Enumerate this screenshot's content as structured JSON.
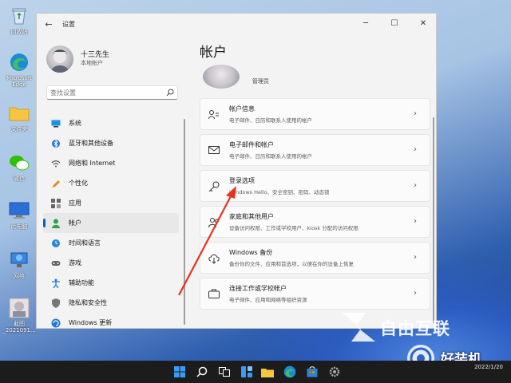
{
  "desktop": {
    "icons": [
      {
        "label": "回收站",
        "icon": "recycle-bin-icon"
      },
      {
        "label": "Microsoft Edge",
        "icon": "edge-icon"
      },
      {
        "label": "文件夹",
        "icon": "folder-icon"
      },
      {
        "label": "微信",
        "icon": "wechat-icon"
      },
      {
        "label": "此电脑",
        "icon": "this-pc-icon"
      },
      {
        "label": "网络",
        "icon": "network-icon"
      },
      {
        "label": "截图_2021091...",
        "icon": "screenshot-file-icon"
      }
    ]
  },
  "window": {
    "title": "设置",
    "back_icon": "back-arrow-icon",
    "controls": {
      "minimize": "─",
      "maximize": "☐",
      "close": "✕"
    }
  },
  "sidebar": {
    "profile": {
      "name": "十三先生",
      "subtitle": "本地帐户"
    },
    "search": {
      "placeholder": "查找设置",
      "value": "查找设置"
    },
    "items": [
      {
        "label": "系统",
        "icon": "system-icon",
        "active": false
      },
      {
        "label": "蓝牙和其他设备",
        "icon": "bluetooth-icon",
        "active": false
      },
      {
        "label": "网络和 Internet",
        "icon": "wifi-icon",
        "active": false
      },
      {
        "label": "个性化",
        "icon": "pen-icon",
        "active": false
      },
      {
        "label": "应用",
        "icon": "apps-icon",
        "active": false
      },
      {
        "label": "帐户",
        "icon": "person-icon",
        "active": true
      },
      {
        "label": "时间和语言",
        "icon": "globe-clock-icon",
        "active": false
      },
      {
        "label": "游戏",
        "icon": "gamepad-icon",
        "active": false
      },
      {
        "label": "辅助功能",
        "icon": "accessibility-icon",
        "active": false
      },
      {
        "label": "隐私和安全性",
        "icon": "shield-icon",
        "active": false
      },
      {
        "label": "Windows 更新",
        "icon": "update-icon",
        "active": false
      }
    ],
    "accent": "#0067c0"
  },
  "main": {
    "title": "帐户",
    "account_role": "管理员",
    "cards": [
      {
        "title": "帐户信息",
        "desc": "电子邮件、日历和联系人使用的帐户",
        "icon": "account-info-icon"
      },
      {
        "title": "电子邮件和帐户",
        "desc": "电子邮件、日历和联系人使用的帐户",
        "icon": "mail-icon"
      },
      {
        "title": "登录选项",
        "desc": "Windows Hello、安全密钥、密码、动态锁",
        "icon": "key-icon"
      },
      {
        "title": "家庭和其他用户",
        "desc": "设备访问权限、工作或学校用户、kiosk 分配的访问权限",
        "icon": "family-icon"
      },
      {
        "title": "Windows 备份",
        "desc": "备份你的文件、应用和首选项，以便在你的设备上恢复",
        "icon": "backup-icon"
      },
      {
        "title": "连接工作或学校帐户",
        "desc": "电子邮件、应用和网络等组织资源",
        "icon": "briefcase-icon"
      }
    ]
  },
  "annotation": {
    "color": "#e8321e"
  },
  "watermark": {
    "line1": "自由互联",
    "line2": "好装机"
  },
  "taskbar": {
    "icons": [
      "start-icon",
      "search-icon",
      "task-view-icon",
      "widgets-icon",
      "file-explorer-icon",
      "edge-icon",
      "store-icon",
      "settings-icon"
    ],
    "date": "2022/1/20"
  }
}
